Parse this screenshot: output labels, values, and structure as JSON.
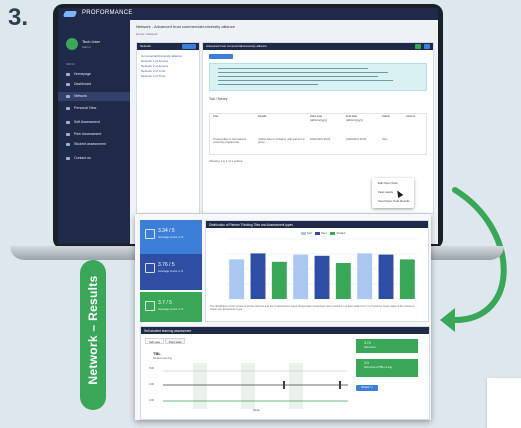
{
  "step_number": "3.",
  "side_label": "Network – Results",
  "app": {
    "brand": "PROFORMANCE",
    "page_title": "Network - Advanced trust commercial/university alliance",
    "breadcrumb": "Home / Network",
    "sidebar": {
      "user_name": "Tech User",
      "user_role": "Admin",
      "menu_title": "MENU",
      "items": [
        {
          "label": "Homepage",
          "icon": "home-icon"
        },
        {
          "label": "Dashboard",
          "icon": "dashboard-icon"
        },
        {
          "label": "Network",
          "icon": "network-icon",
          "active": true
        },
        {
          "label": "Personal View",
          "icon": "user-icon"
        },
        {
          "label": "Self Assessment",
          "icon": "clipboard-icon"
        },
        {
          "label": "Peer Assessment",
          "icon": "users-icon"
        },
        {
          "label": "Student assessment",
          "icon": "student-icon"
        },
        {
          "label": "Contact us",
          "icon": "mail-icon"
        }
      ]
    },
    "left_card": {
      "title": "Network",
      "button": "+ Create",
      "tree": [
        "Commercial/University alliance",
        "Network 1 of Access",
        "Network 2 of Access",
        "Network 3 of Trust",
        "Network 4 of Trust"
      ]
    },
    "right_card": {
      "title": "Advanced trust commercial/university alliance",
      "add_button": "+ Add New Tool",
      "section_title": "Tool / Survey",
      "table_headers": [
        "Title",
        "Details",
        "Start date (dd/mm/yyyy)",
        "End date (dd/mm/yyyy)",
        "Status",
        "Actions"
      ],
      "row": [
        "Trusted allies in international university programmes",
        "Collect data on behalf of, with partners in group...",
        "02/01/2021 00:00",
        "01/04/2021 00:00",
        "Sent"
      ],
      "pager": "Showing 1 to 1 of 1 entries",
      "dropdown": [
        "Edit Open Tools",
        "View results",
        "Send Open Tools Results"
      ]
    }
  },
  "report": {
    "tiles": [
      {
        "value": "3.34 / 5",
        "sub": "Average score 1–5",
        "color": "#3d7fd8"
      },
      {
        "value": "3.76 / 5",
        "sub": "Average score 1–5",
        "color": "#2d4ea3"
      },
      {
        "value": "3.7 / 5",
        "sub": "Average score 1–5",
        "color": "#3aa657"
      }
    ],
    "chart_panel_title": "Distribution of Partner Thinking Tiles and Assessment types",
    "chart_caption": "The distribution of the scores of all the partners and the 3 assessment types. Respondent responses were scored on a Likert scale from 1 to 5 and the mean value of the scores is shown per assessment type.",
    "perf_panel_title": "Self-student learning assessment",
    "tabs": [
      "Self view",
      "Peer view"
    ],
    "line_title": "TBL",
    "line_subtitle": "Student learning",
    "y_labels": [
      "5.00",
      "4.00",
      "3.00"
    ],
    "x_label": "Week",
    "green_boxes": [
      {
        "value": "3.74",
        "sub": "Self score"
      },
      {
        "value": "3.3",
        "sub": "Self score of TBL vs avg"
      }
    ],
    "blue_button": "Details >>"
  },
  "chart_data": {
    "type": "bar",
    "legend": [
      "Self",
      "Peer",
      "Student"
    ],
    "colors": [
      "#a9c7f0",
      "#2d4ea3",
      "#3aa657"
    ],
    "categories": [
      "1",
      "2",
      "3",
      "4",
      "5",
      "6",
      "7",
      "8",
      "9"
    ],
    "values": [
      3.3,
      3.8,
      3.1,
      3.7,
      3.6,
      3.0,
      3.8,
      3.7,
      3.3
    ],
    "series_of_category": [
      0,
      1,
      2,
      0,
      1,
      2,
      0,
      1,
      2
    ],
    "ylim": [
      0,
      5
    ]
  }
}
